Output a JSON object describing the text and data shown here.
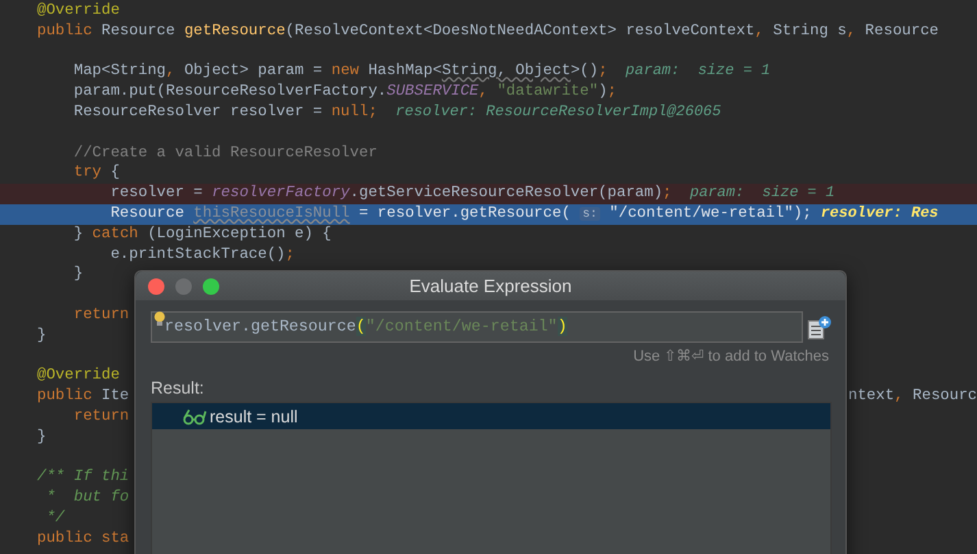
{
  "editor": {
    "lines": [
      {
        "kind": "code",
        "breakpoint": false,
        "current": false,
        "tokens": [
          {
            "kind": "ann",
            "text": "@Override"
          }
        ]
      },
      {
        "kind": "code",
        "breakpoint": false,
        "current": false,
        "tokens": [
          {
            "kind": "kw",
            "text": "public "
          },
          {
            "kind": "plain",
            "text": "Resource "
          },
          {
            "kind": "method",
            "text": "getResource"
          },
          {
            "kind": "plain",
            "text": "(ResolveContext<DoesNotNeedAContext> resolveContext"
          },
          {
            "kind": "kw",
            "text": ", "
          },
          {
            "kind": "plain",
            "text": "String s"
          },
          {
            "kind": "kw",
            "text": ", "
          },
          {
            "kind": "plain",
            "text": "Resource"
          }
        ]
      },
      {
        "kind": "blank"
      },
      {
        "kind": "code",
        "breakpoint": false,
        "current": false,
        "tokens": [
          {
            "kind": "plain",
            "text": "    Map<String"
          },
          {
            "kind": "kw",
            "text": ", "
          },
          {
            "kind": "plain",
            "text": "Object> param = "
          },
          {
            "kind": "kw",
            "text": "new "
          },
          {
            "kind": "plain",
            "text": "HashMap<"
          },
          {
            "kind": "warn",
            "text": "String, Object"
          },
          {
            "kind": "plain",
            "text": ">()"
          },
          {
            "kind": "kw",
            "text": ";"
          },
          {
            "kind": "hint",
            "text": "  param:  size = 1"
          }
        ]
      },
      {
        "kind": "code",
        "breakpoint": false,
        "current": false,
        "tokens": [
          {
            "kind": "plain",
            "text": "    param.put(ResourceResolverFactory."
          },
          {
            "kind": "field",
            "text": "SUBSERVICE"
          },
          {
            "kind": "kw",
            "text": ", "
          },
          {
            "kind": "str",
            "text": "\"datawrite\""
          },
          {
            "kind": "plain",
            "text": ")"
          },
          {
            "kind": "kw",
            "text": ";"
          }
        ]
      },
      {
        "kind": "code",
        "breakpoint": false,
        "current": false,
        "tokens": [
          {
            "kind": "plain",
            "text": "    ResourceResolver resolver = "
          },
          {
            "kind": "kw",
            "text": "null"
          },
          {
            "kind": "kw",
            "text": ";"
          },
          {
            "kind": "hint",
            "text": "  resolver: ResourceResolverImpl@26065"
          }
        ]
      },
      {
        "kind": "blank"
      },
      {
        "kind": "code",
        "breakpoint": false,
        "current": false,
        "tokens": [
          {
            "kind": "comment",
            "text": "    //Create a valid ResourceResolver"
          }
        ]
      },
      {
        "kind": "code",
        "breakpoint": false,
        "current": false,
        "tokens": [
          {
            "kind": "kw",
            "text": "    try "
          },
          {
            "kind": "plain",
            "text": "{"
          }
        ]
      },
      {
        "kind": "code",
        "breakpoint": true,
        "current": false,
        "tokens": [
          {
            "kind": "plain",
            "text": "        resolver = "
          },
          {
            "kind": "field",
            "text": "resolverFactory"
          },
          {
            "kind": "plain",
            "text": ".getServiceResourceResolver(param)"
          },
          {
            "kind": "kw",
            "text": ";"
          },
          {
            "kind": "hint",
            "text": "  param:  size = 1"
          }
        ]
      },
      {
        "kind": "code",
        "breakpoint": false,
        "current": true,
        "tokens": [
          {
            "kind": "plain",
            "text": "        Resource "
          },
          {
            "kind": "unused",
            "text": "thisResouceIsNull"
          },
          {
            "kind": "plain",
            "text": " = resolver.getResource( "
          },
          {
            "kind": "param",
            "text": "s:"
          },
          {
            "kind": "plain",
            "text": " \"/content/we-retail\");"
          },
          {
            "kind": "hint",
            "text": " resolver: Res"
          }
        ]
      },
      {
        "kind": "code",
        "breakpoint": false,
        "current": false,
        "tokens": [
          {
            "kind": "plain",
            "text": "    } "
          },
          {
            "kind": "kw",
            "text": "catch "
          },
          {
            "kind": "plain",
            "text": "(LoginException e) {"
          }
        ]
      },
      {
        "kind": "code",
        "breakpoint": false,
        "current": false,
        "tokens": [
          {
            "kind": "plain",
            "text": "        e.printStackTrace()"
          },
          {
            "kind": "kw",
            "text": ";"
          }
        ]
      },
      {
        "kind": "code",
        "breakpoint": false,
        "current": false,
        "tokens": [
          {
            "kind": "plain",
            "text": "    }"
          }
        ]
      },
      {
        "kind": "blank"
      },
      {
        "kind": "code",
        "breakpoint": false,
        "current": false,
        "tokens": [
          {
            "kind": "kw",
            "text": "    return"
          }
        ]
      },
      {
        "kind": "code",
        "breakpoint": false,
        "current": false,
        "tokens": [
          {
            "kind": "plain",
            "text": "}"
          }
        ]
      },
      {
        "kind": "blank"
      },
      {
        "kind": "code",
        "breakpoint": false,
        "current": false,
        "tokens": [
          {
            "kind": "ann",
            "text": "@Override"
          }
        ]
      },
      {
        "kind": "code",
        "breakpoint": false,
        "current": false,
        "tokens": [
          {
            "kind": "kw",
            "text": "public "
          },
          {
            "kind": "plain",
            "text": "Ite"
          }
        ],
        "right_tokens": [
          {
            "kind": "plain",
            "text": "ntext"
          },
          {
            "kind": "kw",
            "text": ", "
          },
          {
            "kind": "plain",
            "text": "Resourc"
          }
        ]
      },
      {
        "kind": "code",
        "breakpoint": false,
        "current": false,
        "tokens": [
          {
            "kind": "kw",
            "text": "    return"
          }
        ]
      },
      {
        "kind": "code",
        "breakpoint": false,
        "current": false,
        "tokens": [
          {
            "kind": "plain",
            "text": "}"
          }
        ]
      },
      {
        "kind": "blank"
      },
      {
        "kind": "code",
        "breakpoint": false,
        "current": false,
        "tokens": [
          {
            "kind": "doc",
            "text": "/** If thi"
          }
        ]
      },
      {
        "kind": "code",
        "breakpoint": false,
        "current": false,
        "tokens": [
          {
            "kind": "doc",
            "text": " *  but fo"
          }
        ]
      },
      {
        "kind": "code",
        "breakpoint": false,
        "current": false,
        "tokens": [
          {
            "kind": "doc",
            "text": " */"
          }
        ]
      },
      {
        "kind": "code",
        "breakpoint": false,
        "current": false,
        "tokens": [
          {
            "kind": "kw",
            "text": "public sta"
          }
        ]
      }
    ]
  },
  "dialog": {
    "title": "Evaluate Expression",
    "expression": [
      {
        "kind": "plain",
        "text": "resolver.getResource"
      },
      {
        "kind": "paren",
        "text": "("
      },
      {
        "kind": "str",
        "text": "\"/content/we-retail\""
      },
      {
        "kind": "paren",
        "text": ")"
      }
    ],
    "hint": "Use ⇧⌘⏎ to add to Watches",
    "result_label": "Result:",
    "results": [
      {
        "text": "result = null",
        "selected": true
      }
    ]
  }
}
